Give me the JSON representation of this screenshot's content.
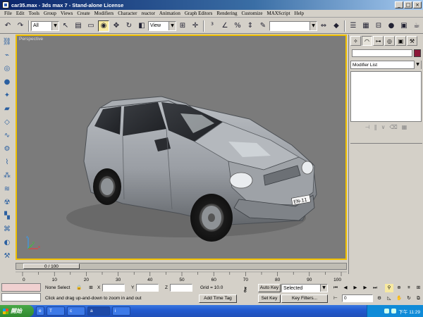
{
  "window": {
    "title": "car35.max - 3ds max 7 - Stand-alone License",
    "controls": [
      "_",
      "□",
      "×"
    ]
  },
  "menu": [
    "File",
    "Edit",
    "Tools",
    "Group",
    "Views",
    "Create",
    "Modifiers",
    "Character",
    "reactor",
    "Animation",
    "Graph Editors",
    "Rendering",
    "Customize",
    "MAXScript",
    "Help"
  ],
  "toolbar": {
    "selection_filter": "All",
    "ref_coord": "View",
    "named_sel_placeholder": ""
  },
  "viewport": {
    "label": "Perspective",
    "axis_labels": {
      "x": "x",
      "y": "y",
      "z": "z"
    },
    "license_plate": "EN-11"
  },
  "timeline": {
    "frame_display": "0 / 100",
    "ticks": [
      "0",
      "10",
      "20",
      "30",
      "40",
      "50",
      "60",
      "70",
      "80",
      "90",
      "100"
    ]
  },
  "command_panel": {
    "modifier_list_label": "Modifier List",
    "object_color": "#8c1738"
  },
  "status": {
    "selection_text": "None Select",
    "x_label": "X",
    "y_label": "Y",
    "z_label": "Z",
    "grid_text": "Grid = 10.0",
    "prompt": "Click and drag up-and-down to zoom in and out",
    "add_time_tag": "Add Time Tag",
    "auto_key": "Auto Key",
    "set_key": "Set Key",
    "selected_dropdown": "Selected",
    "key_filters": "Key Filters...",
    "frame_value": "0"
  },
  "taskbar": {
    "start_label": "開始",
    "tasks": [
      "T",
      "c",
      "a",
      "i"
    ],
    "clock": "下午 11:29"
  }
}
